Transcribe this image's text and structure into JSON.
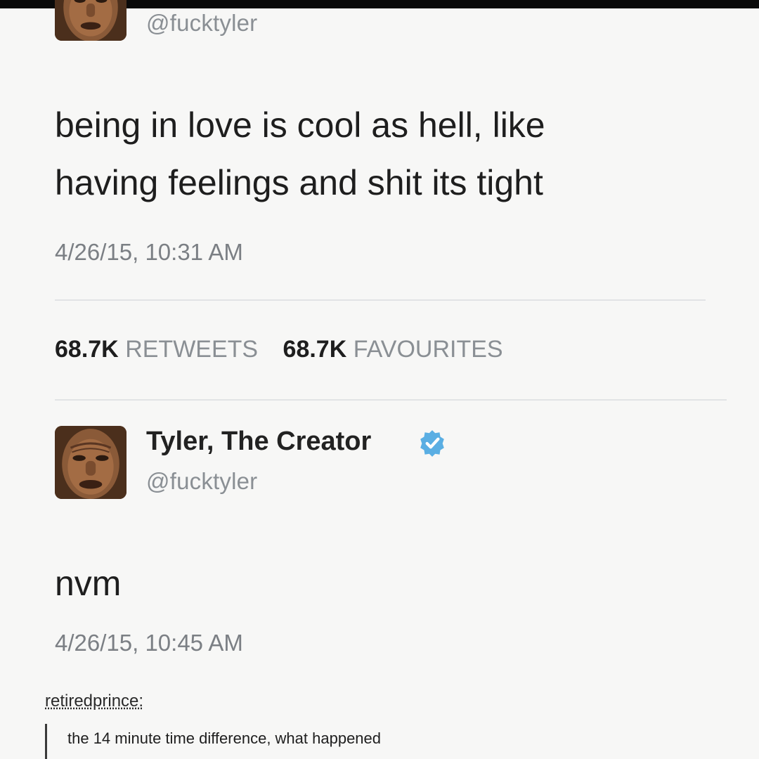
{
  "tweet1": {
    "handle": "@fucktyler",
    "text_line1": "being in love is cool as hell, like",
    "text_line2": "having feelings and shit its tight",
    "timestamp": "4/26/15, 10:31 AM",
    "retweets_count": "68.7K",
    "retweets_label": "RETWEETS",
    "favourites_count": "68.7K",
    "favourites_label": "FAVOURITES"
  },
  "tweet2": {
    "display_name": "Tyler, The Creator",
    "handle": "@fucktyler",
    "verified_icon": "verified-badge-icon",
    "text": "nvm",
    "timestamp": "4/26/15, 10:45 AM"
  },
  "reblog": {
    "username": "retiredprince:",
    "comment": "the 14 minute time difference, what happened"
  },
  "colors": {
    "verified_blue": "#4aa3df",
    "muted_gray": "#8a8f94"
  }
}
